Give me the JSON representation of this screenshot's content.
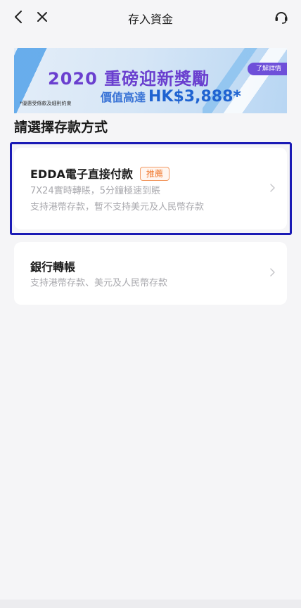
{
  "nav": {
    "title": "存入資金",
    "back_icon": "chevron-left-icon",
    "close_icon": "close-icon",
    "support_icon": "headset-icon"
  },
  "banner": {
    "headline": "2020 重磅迎新獎勵",
    "sub_prefix": "價值高達",
    "sub_amount": "HK$3,888*",
    "note": "*優惠受條款及細則約束",
    "button": "了解詳情"
  },
  "section_title": "請選擇存款方式",
  "methods": [
    {
      "title": "EDDA電子直接付款",
      "tag": "推薦",
      "line1": "7X24實時轉賬，5分鐘極速到賬",
      "line2": "支持港幣存款，暫不支持美元及人民幣存款"
    },
    {
      "title": "銀行轉帳",
      "line1": "支持港幣存款、美元及人民幣存款"
    }
  ],
  "colors": {
    "accent_purple": "#6a3fcf",
    "tag_orange": "#f07a30",
    "highlight_blue": "#1b1bb5"
  }
}
